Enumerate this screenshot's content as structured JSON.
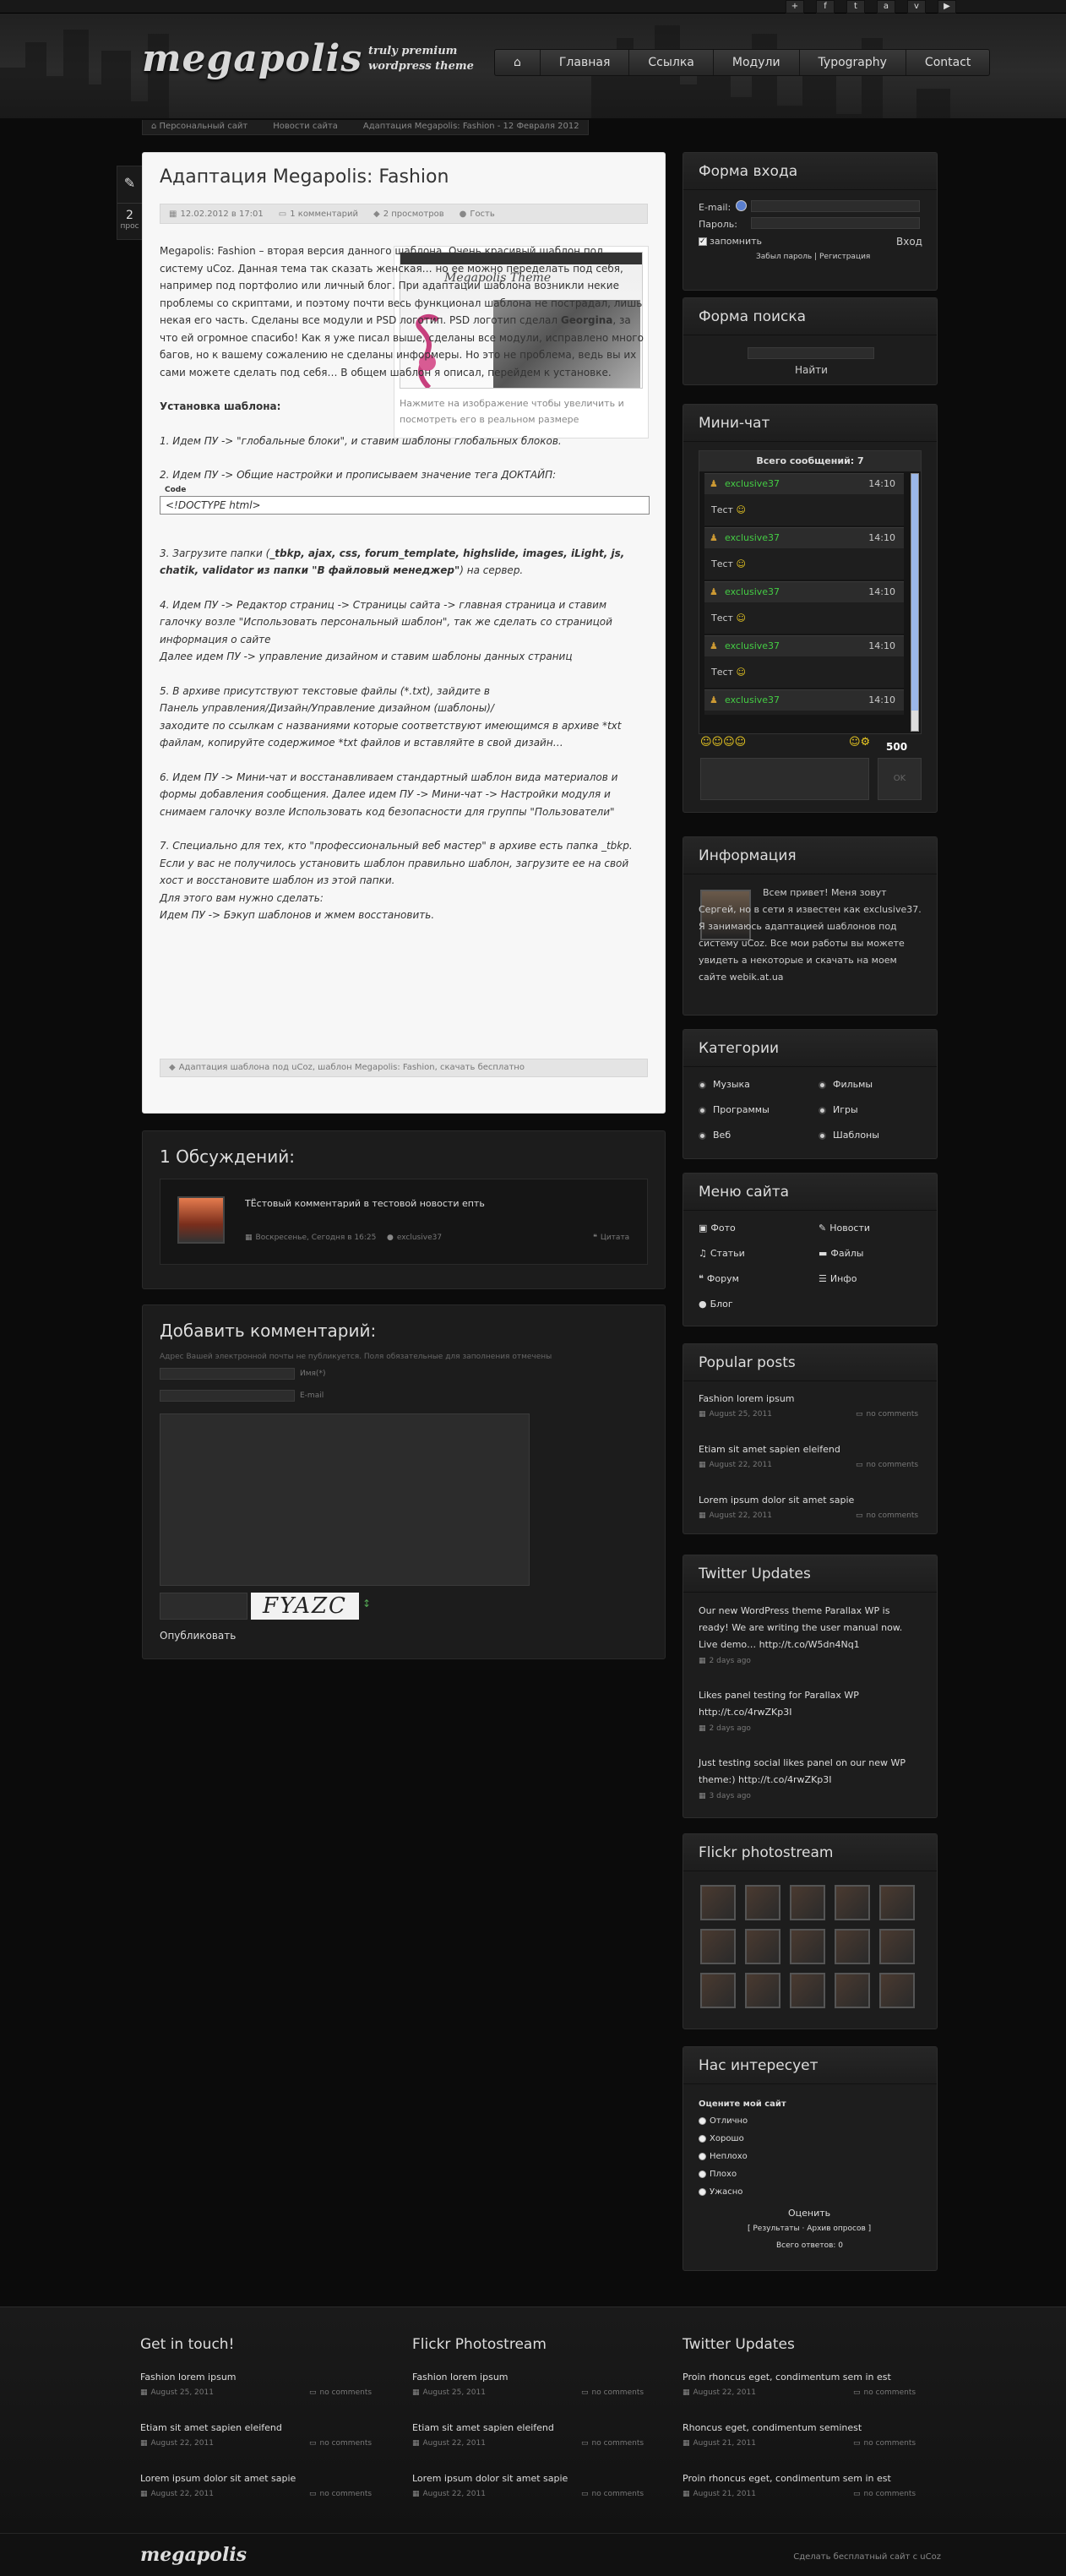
{
  "social": [
    "+",
    "f",
    "t",
    "a",
    "v",
    "▶"
  ],
  "logo": "megapolis",
  "tagline": [
    "truly premium",
    "wordpress theme"
  ],
  "nav": [
    "Главная",
    "Ссылка",
    "Модули",
    "Typography",
    "Contact"
  ],
  "breadcrumb": [
    "Персональный сайт",
    "Новости сайта",
    "Адаптация Megapolis: Fashion - 12 Февраля 2012"
  ],
  "side_count": {
    "num": "2",
    "label": "прос"
  },
  "post": {
    "title": "Адаптация Megapolis: Fashion",
    "meta": [
      "12.02.2012 в 17:01",
      "1 комментарий",
      "2 просмотров",
      "Гость"
    ],
    "thumb_caption": "Нажмите на изображение чтобы увеличить и посмотреть его в реальном размере",
    "thumb_logo": "Megapolis Theme",
    "intro": "Megapolis: Fashion – вторая версия данного шаблона. Очень красивый шаблон под систему uCoz. Данная тема так сказать женская… но ее можно переделать под себя, например под портфолио или личный блог. При адаптации шаблона возникли некие проблемы со скриптами, и поэтому почти весь функционал шаблона не пострадал, лишь некая его часть. Сделаны все модули и PSD логотип. PSD логотип сделал",
    "intro_name": "Georgina",
    "intro_end": ", за что ей огромное спасибо! Как я уже писал выше, сделаны все модули, исправлено много багов, но к вашему сожалению не сделаны информеры. Но это не проблема, ведь вы их сами можете сделать под себя… В общем шаблон я описал, перейдем к установке.",
    "install_title": "Установка шаблона:",
    "step1": "1. Идем ПУ -> \"глобальные блоки\", и ставим шаблоны глобальных блоков.",
    "step2": "2. Идем ПУ -> Общие настройки и прописываем значение тега ДОКТАЙП:",
    "code_label": "Code",
    "code": "<!DOCTYPE html>",
    "step3a": "3. Загрузите папки (",
    "step3b": "_tbkp, ajax, css, forum_template, highslide, images, iLight, js, chatik, validator из папки \"В файловый менеджер\"",
    "step3c": ") на сервер.",
    "step4": "4. Идем ПУ -> Редактор страниц -> Страницы сайта -> главная страница и ставим галочку возле \"Использовать персональный шаблон\", так же сделать со страницой информация о сайте",
    "step4b": "Далее идем ПУ -> управление дизайном и ставим шаблоны данных страниц",
    "step5": "5. В архиве присутствуют текстовые файлы (*.txt), зайдите в",
    "step5b": "Панель управления/Дизайн/Управление дизайном (шаблоны)/",
    "step5c": "заходите по ссылкам с названиями которые соответствуют имеющимся в архиве *txt файлам, копируйте содержимое *txt файлов и вставляйте в свой дизайн…",
    "step6": "6. Идем ПУ -> Мини-чат и восстанавливаем стандартный шаблон вида материалов и формы добавления сообщения. Далее идем ПУ -> Мини-чат -> Настройки модуля и снимаем галочку возле Использовать код безопасности для группы \"Пользователи\"",
    "step7": "7. Специально для тех, кто \"профессиональный веб мастер\" в архиве есть папка _tbkp. Если у вас не получилось установить шаблон правильно шаблон, загрузите ее на свой хост и восстановите шаблон из этой папки.",
    "step7b": "Для этого вам нужно сделать:",
    "step7c": "Идем ПУ -> Бэкуп шаблонов и жмем восстановить.",
    "tags": "Адаптация шаблона под uCoz, шаблон Megapolis: Fashion, скачать бесплатно"
  },
  "comments": {
    "title": "1 Обсуждений:",
    "text": "ТЁстовый комментарий в тестовой новости епть",
    "date": "Воскресенье, Сегодня в 16:25",
    "author": "exclusive37",
    "quote": "Цитата"
  },
  "addcomment": {
    "title": "Добавить комментарий:",
    "note": "Адрес Вашей электронной почты не публикуется. Поля обязательные для заполнения отмечены",
    "name_label": "Имя(*)",
    "email_label": "E-mail",
    "captcha": "FYAZC",
    "submit": "Опубликовать"
  },
  "login": {
    "title": "Форма входа",
    "email_label": "E-mail:",
    "password_label": "Пароль:",
    "remember": "запомнить",
    "enter": "Вход",
    "links": "Забыл пароль | Регистрация"
  },
  "search": {
    "title": "Форма поиска",
    "button": "Найти"
  },
  "chat": {
    "title": "Мини-чат",
    "total": "Всего сообщений: 7",
    "user": "exclusive37",
    "time": "14:10",
    "msg": "Тест",
    "count": "500",
    "ok": "OK"
  },
  "info": {
    "title": "Информация",
    "text": "Всем привет! Меня зовут Сергей, но в сети я известен как exclusive37. Я занимаюсь адаптацией шаблонов под систему uCoz. Все мои работы вы можете увидеть а некоторые и скачать на моем сайте webik.at.ua"
  },
  "categories": {
    "title": "Категории",
    "items": [
      "Музыка",
      "Фильмы",
      "Программы",
      "Игры",
      "Веб",
      "Шаблоны"
    ]
  },
  "menu": {
    "title": "Меню сайта",
    "items": [
      "Фото",
      "Новости",
      "Статьи",
      "Файлы",
      "Форум",
      "Инфо",
      "Блог"
    ]
  },
  "popular": {
    "title": "Popular posts",
    "items": [
      {
        "t": "Fashion lorem ipsum",
        "d": "August 25, 2011",
        "c": "no comments"
      },
      {
        "t": "Etiam sit amet sapien eleifend",
        "d": "August 22, 2011",
        "c": "no comments"
      },
      {
        "t": "Lorem ipsum dolor sit amet sapie",
        "d": "August 22, 2011",
        "c": "no comments"
      }
    ]
  },
  "twitter": {
    "title": "Twitter Updates",
    "items": [
      {
        "t": "Our new WordPress theme Parallax WP is ready! We are writing the user manual now. Live demo… http://t.co/W5dn4Nq1",
        "d": "2 days ago"
      },
      {
        "t": "Likes panel testing for Parallax WP http://t.co/4rwZKp3I",
        "d": "2 days ago"
      },
      {
        "t": "Just testing social likes panel on our new WP theme:) http://t.co/4rwZKp3I",
        "d": "3 days ago"
      }
    ]
  },
  "flickr": {
    "title": "Flickr photostream"
  },
  "poll": {
    "title": "Нас интересует",
    "question": "Оцените мой сайт",
    "options": [
      "Отлично",
      "Хорошо",
      "Неплохо",
      "Плохо",
      "Ужасно"
    ],
    "button": "Оценить",
    "links": "[ Результаты · Архив опросов ]",
    "total": "Всего ответов: 0"
  },
  "footer": {
    "col1": {
      "title": "Get in touch!",
      "items": [
        {
          "t": "Fashion lorem ipsum",
          "d": "August 25, 2011"
        },
        {
          "t": "Etiam sit amet sapien eleifend",
          "d": "August 22, 2011"
        },
        {
          "t": "Lorem ipsum dolor sit amet sapie",
          "d": "August 22, 2011"
        }
      ]
    },
    "col2": {
      "title": "Flickr Photostream",
      "items": [
        {
          "t": "Fashion lorem ipsum",
          "d": "August 25, 2011"
        },
        {
          "t": "Etiam sit amet sapien eleifend",
          "d": "August 22, 2011"
        },
        {
          "t": "Lorem ipsum dolor sit amet sapie",
          "d": "August 22, 2011"
        }
      ]
    },
    "col3": {
      "title": "Twitter Updates",
      "items": [
        {
          "t": "Proin rhoncus eget, condimentum sem in est",
          "d": "August 22, 2011"
        },
        {
          "t": "Rhoncus eget, condimentum seminest",
          "d": "August 21, 2011"
        },
        {
          "t": "Proin rhoncus eget, condimentum sem in est",
          "d": "August 21, 2011"
        }
      ]
    },
    "comments": "no comments",
    "logo": "megapolis",
    "credit": "Сделать бесплатный сайт с uCoz"
  }
}
